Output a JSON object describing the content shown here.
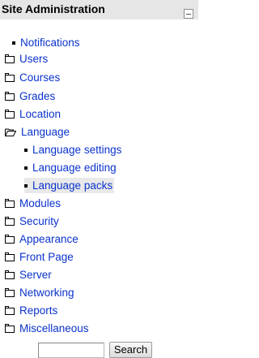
{
  "block": {
    "title": "Site Administration"
  },
  "tree": {
    "notifications": "Notifications",
    "users": "Users",
    "courses": "Courses",
    "grades": "Grades",
    "location": "Location",
    "language": "Language",
    "language_settings": "Language settings",
    "language_editing": "Language editing",
    "language_packs": "Language packs",
    "modules": "Modules",
    "security": "Security",
    "appearance": "Appearance",
    "front_page": "Front Page",
    "server": "Server",
    "networking": "Networking",
    "reports": "Reports",
    "miscellaneous": "Miscellaneous"
  },
  "search": {
    "value": "",
    "button_label": "Search"
  }
}
